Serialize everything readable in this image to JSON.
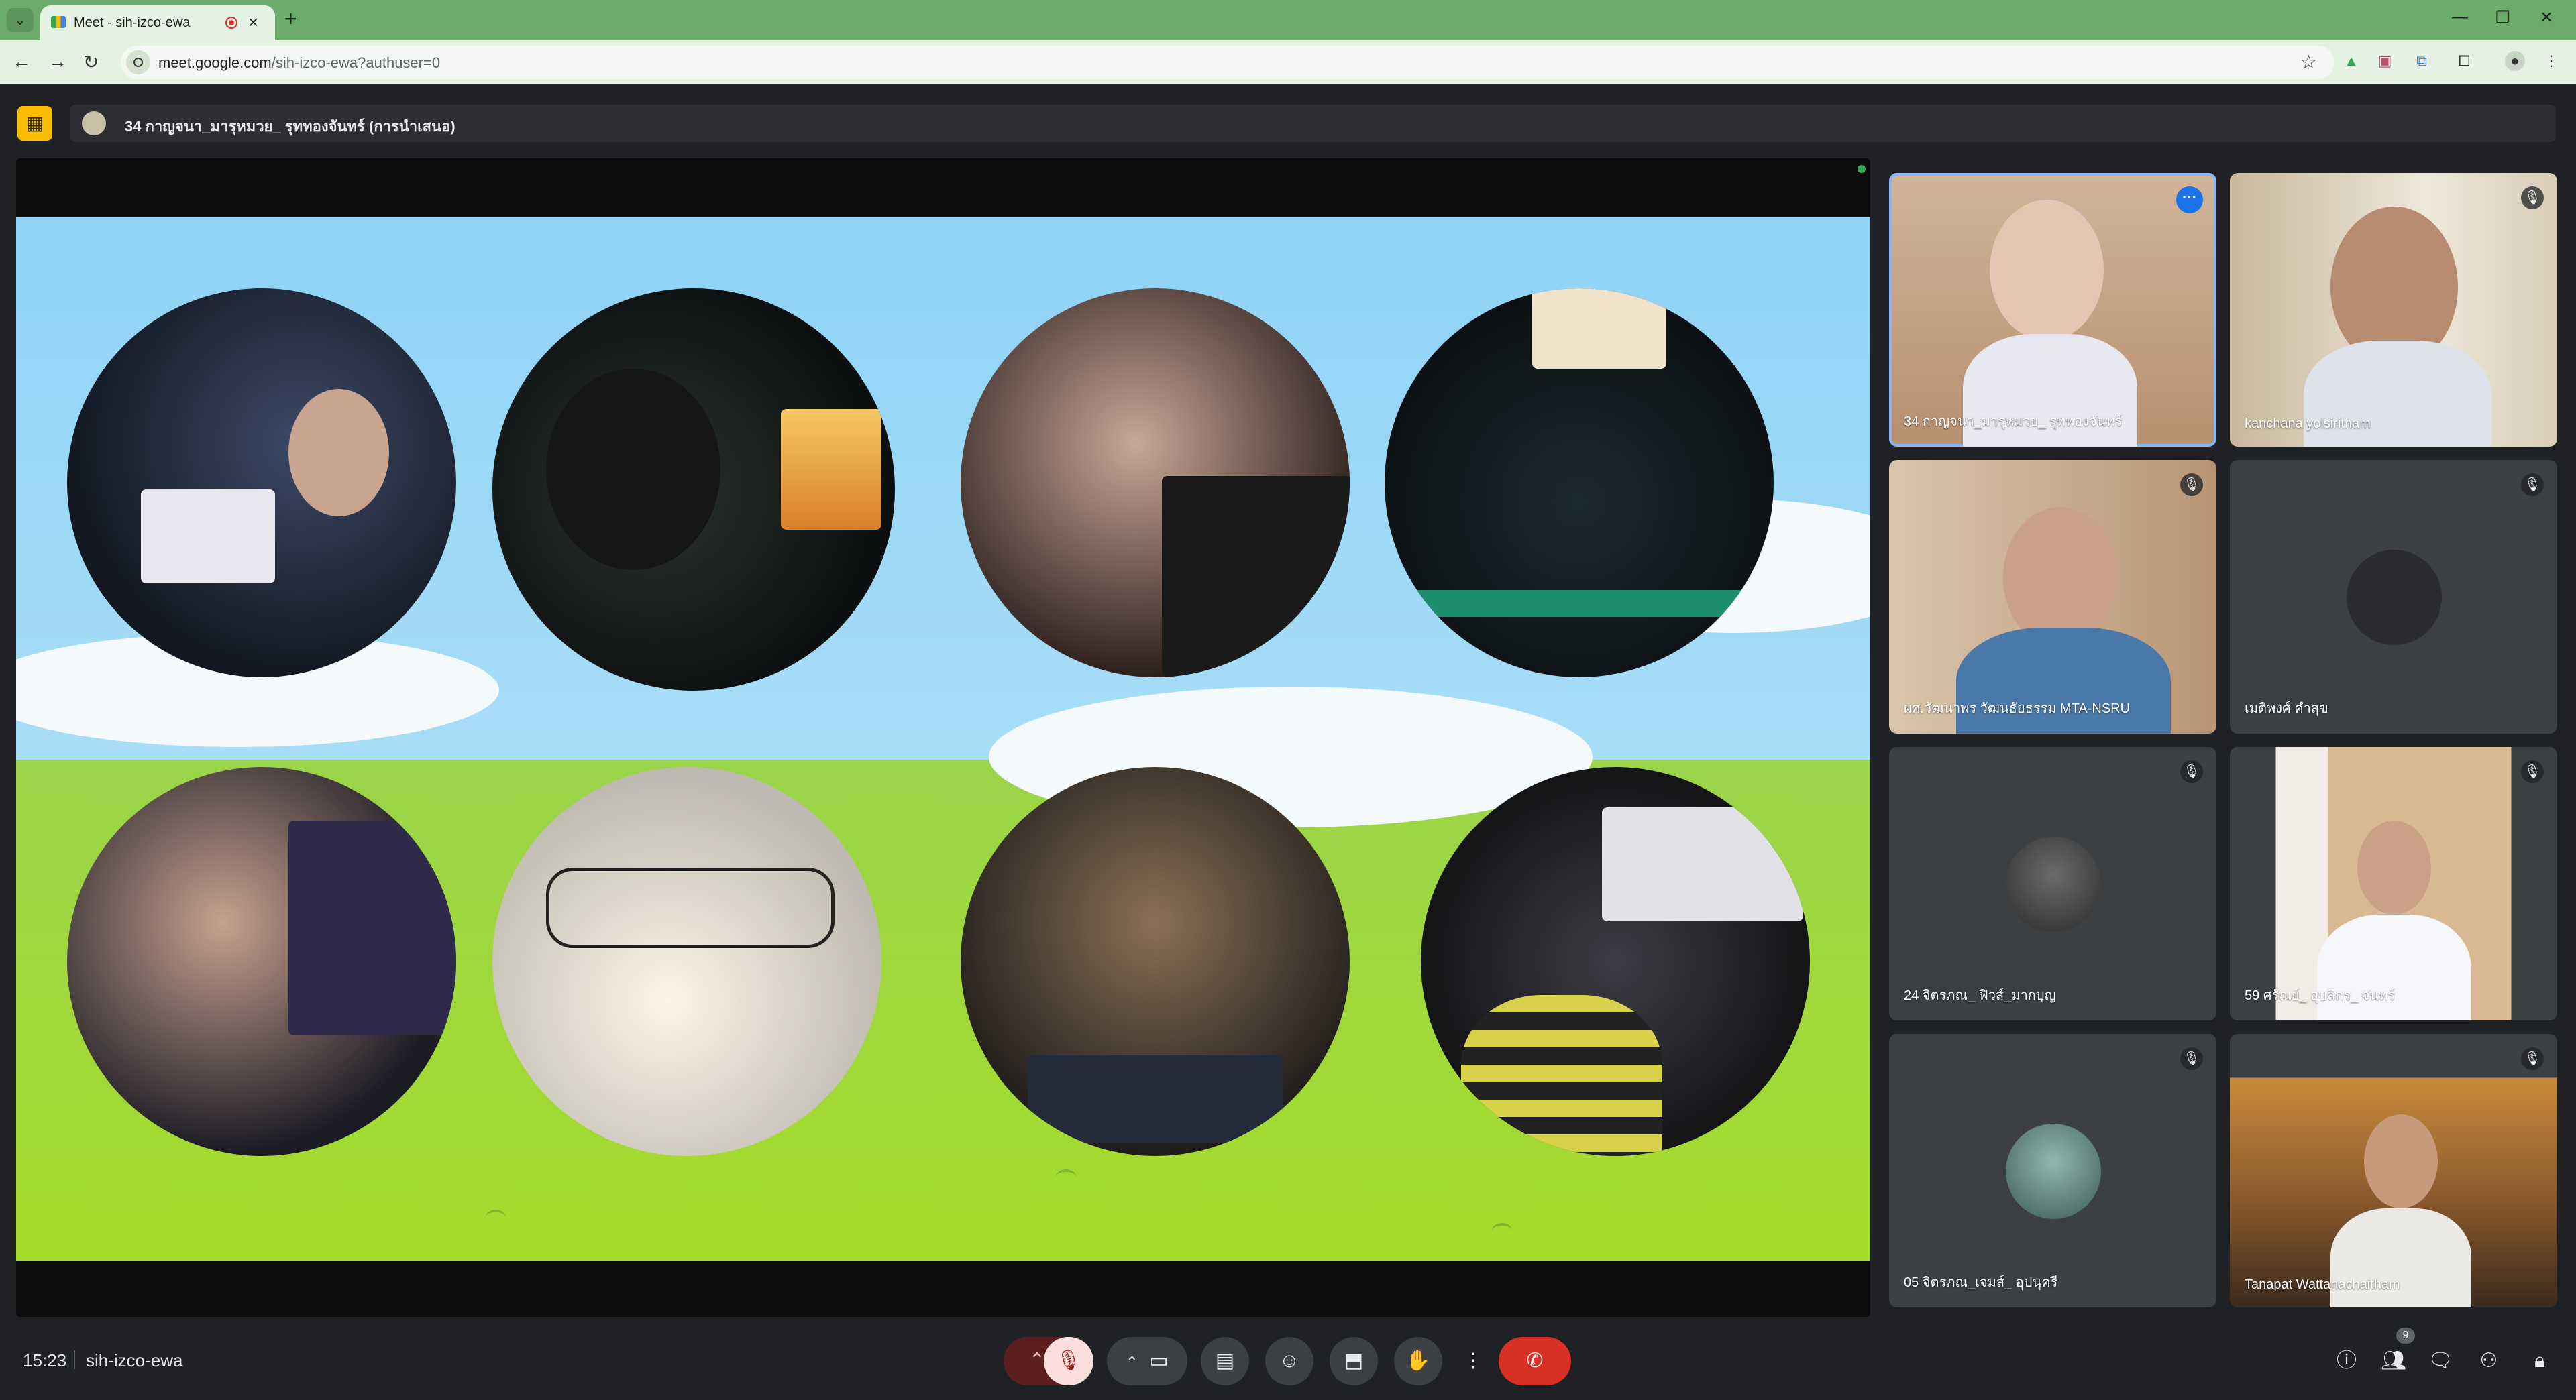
{
  "browser": {
    "tab_title": "Meet - sih-izco-ewa",
    "url_host": "meet.google.com",
    "url_path": "/sih-izco-ewa?authuser=0"
  },
  "presentation": {
    "label": "34 กาญจนา_มารุหมวย_ รุททองจันทร์ (การนำเสนอ)"
  },
  "participants": [
    {
      "name": "34 กาญจนา_มารุหมวย_ รุททองจันทร์",
      "muted": false,
      "active": true
    },
    {
      "name": "kanchana yolsiritham",
      "muted": true,
      "active": false
    },
    {
      "name": "ผศ.วัฒนาพร วัฒนธัยธรรม MTA-NSRU",
      "muted": true,
      "active": false
    },
    {
      "name": "เมติพงศ์ คำสุข",
      "muted": true,
      "active": false
    },
    {
      "name": "24 จิตรภณ_ ฟิวส์_มากบุญ",
      "muted": true,
      "active": false
    },
    {
      "name": "59 ศรัณย์_ อุบลิกร_ จันทร์",
      "muted": true,
      "active": false
    },
    {
      "name": "05 จิตรภณ_เจมส์_ อุปนุครี",
      "muted": true,
      "active": false
    },
    {
      "name": "Tanapat Wattanachaitham",
      "muted": true,
      "active": false
    }
  ],
  "footer": {
    "time": "15:23",
    "meeting_code": "sih-izco-ewa",
    "people_count": "9"
  }
}
